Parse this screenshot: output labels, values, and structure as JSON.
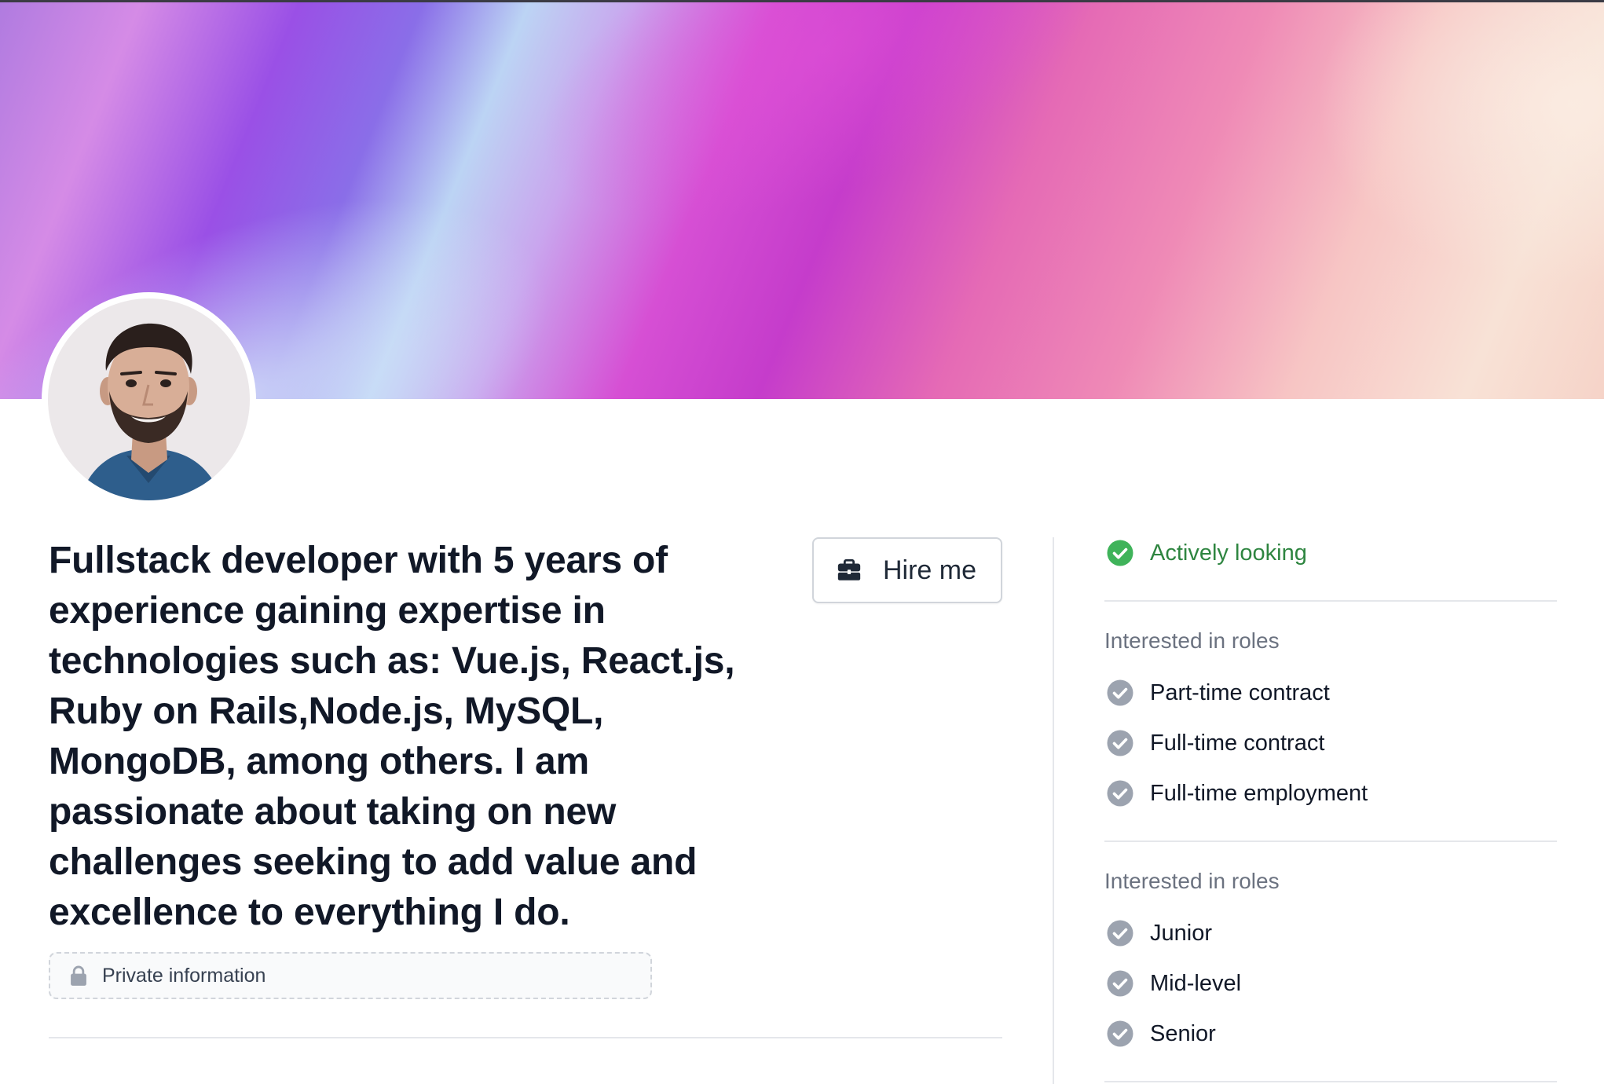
{
  "profile": {
    "bio": "Fullstack developer with 5 years of experience gaining expertise in technologies such as: Vue.js, React.js, Ruby on Rails,Node.js, MySQL, MongoDB, among others. I am passionate about taking on new challenges seeking to add value and excellence to everything I do.",
    "hire_label": "Hire me",
    "private_label": "Private information"
  },
  "status": {
    "label": "Actively looking",
    "color": "#2e8540"
  },
  "roles_section": {
    "title": "Interested in roles",
    "items": [
      "Part-time contract",
      "Full-time contract",
      "Full-time employment"
    ]
  },
  "levels_section": {
    "title": "Interested in roles",
    "items": [
      "Junior",
      "Mid-level",
      "Senior"
    ]
  },
  "icons": {
    "hire": "briefcase-icon",
    "private": "lock-icon",
    "status": "check-circle-icon",
    "item": "check-circle-icon"
  },
  "colors": {
    "accent_green": "#3fb35a",
    "check_gray": "#9ca3af",
    "text_dark": "#111827",
    "muted": "#6b7280"
  }
}
